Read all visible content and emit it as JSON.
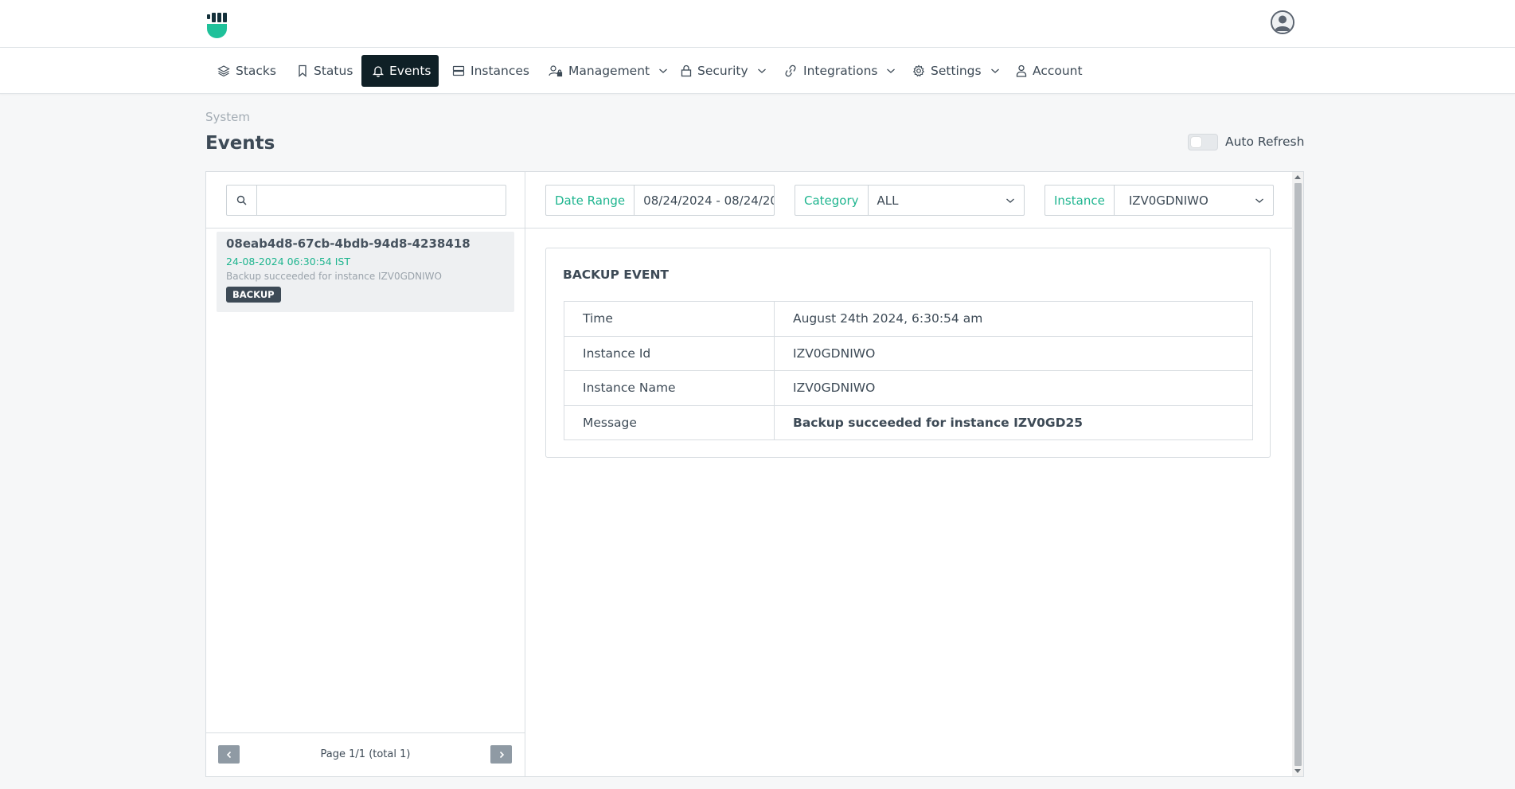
{
  "nav": {
    "items": [
      {
        "label": "Stacks",
        "icon": "layers-icon"
      },
      {
        "label": "Status",
        "icon": "bookmark-icon"
      },
      {
        "label": "Events",
        "icon": "bell-icon",
        "active": true
      },
      {
        "label": "Instances",
        "icon": "server-icon"
      },
      {
        "label": "Management",
        "icon": "user-lock-icon",
        "dropdown": true
      },
      {
        "label": "Security",
        "icon": "lock-icon",
        "dropdown": true
      },
      {
        "label": "Integrations",
        "icon": "link-icon",
        "dropdown": true
      },
      {
        "label": "Settings",
        "icon": "gear-icon",
        "dropdown": true
      },
      {
        "label": "Account",
        "icon": "user-icon"
      }
    ]
  },
  "page": {
    "breadcrumb": "System",
    "title": "Events",
    "auto_refresh_label": "Auto Refresh",
    "auto_refresh_on": false
  },
  "search": {
    "value": "",
    "placeholder": ""
  },
  "events": [
    {
      "id": "08eab4d8-67cb-4bdb-94d8-4238418",
      "time": "24-08-2024 06:30:54 IST",
      "message": "Backup succeeded for instance IZV0GDNIWO",
      "badge": "BACKUP"
    }
  ],
  "pagination": {
    "text": "Page 1/1 (total 1)"
  },
  "filters": {
    "date_range": {
      "label": "Date Range",
      "value": "08/24/2024 - 08/24/20"
    },
    "category": {
      "label": "Category",
      "value": "ALL"
    },
    "instance": {
      "label": "Instance",
      "value": "IZV0GDNIWO"
    }
  },
  "detail": {
    "title": "BACKUP EVENT",
    "rows": [
      {
        "key": "Time",
        "value": "August 24th 2024, 6:30:54 am"
      },
      {
        "key": "Instance Id",
        "value": "IZV0GDNIWO"
      },
      {
        "key": "Instance Name",
        "value": "IZV0GDNIWO"
      },
      {
        "key": "Message",
        "value": "Backup succeeded for instance IZV0GD25"
      }
    ]
  },
  "colors": {
    "accent": "#1fb58f",
    "nav_active": "#0f2026",
    "badge": "#3d4a56"
  }
}
